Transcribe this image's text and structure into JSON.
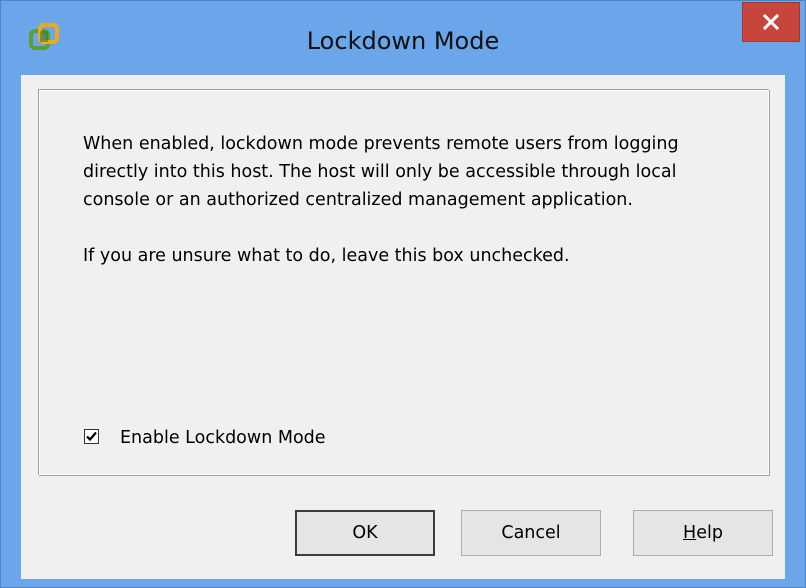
{
  "window": {
    "title": "Lockdown Mode",
    "icon": "vsphere-app-icon",
    "close_icon": "close-icon",
    "close_color": "#c7453a",
    "frame_color": "#6aa6e9"
  },
  "description": {
    "lines": [
      "When enabled, lockdown mode prevents remote users from logging",
      "directly into this host. The host will only be accessible through local",
      "console or an authorized centralized management application."
    ],
    "hint": "If you are unsure what to do, leave this box unchecked."
  },
  "lockdown_checkbox": {
    "label": "Enable Lockdown Mode",
    "checked": true
  },
  "buttons": {
    "ok": "OK",
    "cancel": "Cancel",
    "help_accel": "H",
    "help_rest": "elp"
  }
}
